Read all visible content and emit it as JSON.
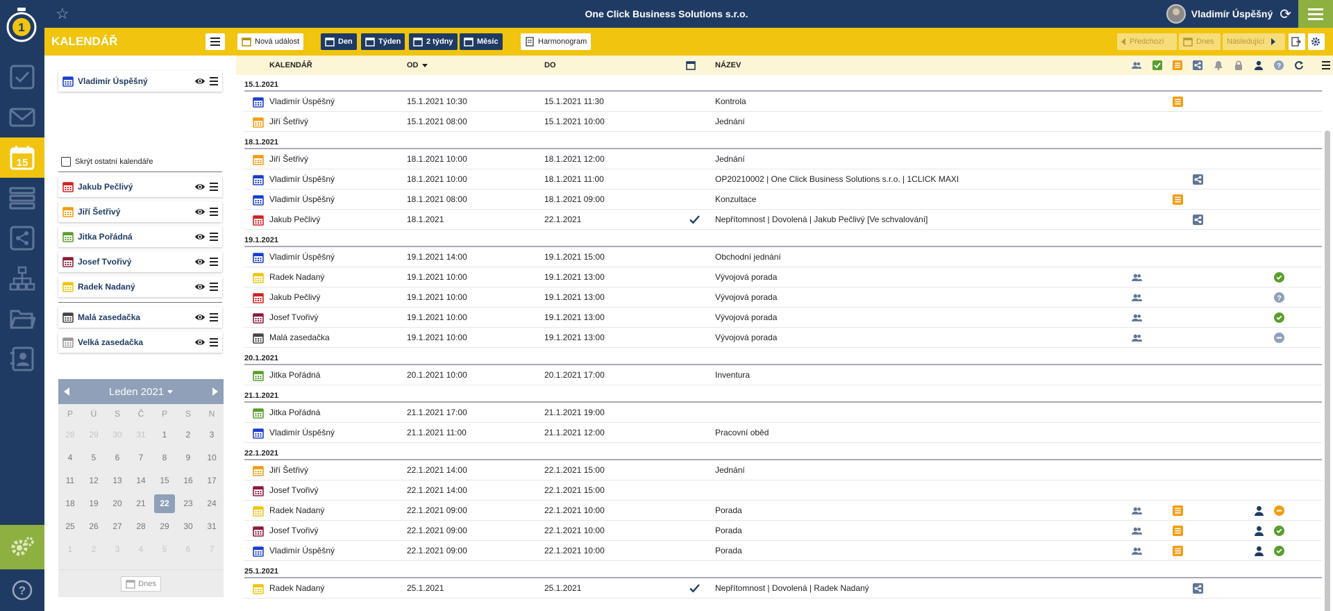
{
  "app": {
    "company": "One Click Business Solutions s.r.o.",
    "user_name": "Vladimír Úspěšný",
    "section_title": "KALENDÁŘ"
  },
  "toolbar": {
    "new_event": "Nová událost",
    "day": "Den",
    "week": "Týden",
    "two_weeks": "2 týdny",
    "month": "Měsíc",
    "schedule": "Harmonogram",
    "prev": "Předchozí",
    "today": "Dnes",
    "next": "Následující"
  },
  "calendars": {
    "own": {
      "name": "Vladimír Úspěšný",
      "color": "#1a3fcf"
    },
    "hide_others_label": "Skrýt ostatní kalendáře",
    "others": [
      {
        "name": "Jakub Pečlivý",
        "color": "#d32121"
      },
      {
        "name": "Jiří Šetřivý",
        "color": "#f39c12"
      },
      {
        "name": "Jitka Pořádná",
        "color": "#5a9e2f"
      },
      {
        "name": "Josef Tvořivý",
        "color": "#8b1a3a"
      },
      {
        "name": "Radek Nadaný",
        "color": "#f1c40f"
      }
    ],
    "rooms": [
      {
        "name": "Malá zasedačka",
        "color": "#444444"
      },
      {
        "name": "Velká zasedačka",
        "color": "#999999"
      }
    ]
  },
  "mini_calendar": {
    "month_label": "Leden 2021",
    "weekdays": [
      "P",
      "Ú",
      "S",
      "Č",
      "P",
      "S",
      "N"
    ],
    "days": [
      "28",
      "29",
      "30",
      "31",
      "1",
      "2",
      "3",
      "4",
      "5",
      "6",
      "7",
      "8",
      "9",
      "10",
      "11",
      "12",
      "13",
      "14",
      "15",
      "16",
      "17",
      "18",
      "19",
      "20",
      "21",
      "22",
      "23",
      "24",
      "25",
      "26",
      "27",
      "28",
      "29",
      "30",
      "31",
      "1",
      "2",
      "3",
      "4",
      "5",
      "6",
      "7"
    ],
    "today_label": "Dnes"
  },
  "table": {
    "headers": {
      "calendar": "KALENDÁŘ",
      "from": "OD",
      "to": "DO",
      "title": "NÁZEV"
    },
    "groups": [
      {
        "date": "15.1.2021",
        "rows": [
          {
            "cal": "Vladimír Úspěšný",
            "color": "#1a3fcf",
            "from": "15.1.2021 10:30",
            "to": "15.1.2021 11:30",
            "title": "Kontrola",
            "icons": [
              "project"
            ]
          },
          {
            "cal": "Jiří Šetřivý",
            "color": "#f39c12",
            "from": "15.1.2021 08:00",
            "to": "15.1.2021 10:00",
            "title": "Jednání",
            "icons": []
          }
        ]
      },
      {
        "date": "18.1.2021",
        "rows": [
          {
            "cal": "Jiří Šetřivý",
            "color": "#f39c12",
            "from": "18.1.2021 10:00",
            "to": "18.1.2021 12:00",
            "title": "Jednání",
            "icons": []
          },
          {
            "cal": "Vladimír Úspěšný",
            "color": "#1a3fcf",
            "from": "18.1.2021 10:00",
            "to": "18.1.2021 11:00",
            "title": "OP20210002 | One Click Business Solutions s.r.o. | 1CLICK MAXI",
            "icons": [
              "process"
            ]
          },
          {
            "cal": "Vladimír Úspěšný",
            "color": "#1a3fcf",
            "from": "18.1.2021 08:00",
            "to": "18.1.2021 09:00",
            "title": "Konzultace",
            "icons": [
              "project"
            ]
          },
          {
            "cal": "Jakub Pečlivý",
            "color": "#d32121",
            "from": "18.1.2021",
            "to": "22.1.2021",
            "title": "Nepřítomnost | Dovolená | Jakub Pečlivý [Ve schvalování]",
            "allday": true,
            "icons": [
              "process"
            ]
          }
        ]
      },
      {
        "date": "19.1.2021",
        "rows": [
          {
            "cal": "Vladimír Úspěšný",
            "color": "#1a3fcf",
            "from": "19.1.2021 14:00",
            "to": "19.1.2021 15:00",
            "title": "Obchodní jednání",
            "icons": []
          },
          {
            "cal": "Radek Nadaný",
            "color": "#f1c40f",
            "from": "19.1.2021 10:00",
            "to": "19.1.2021 13:00",
            "title": "Vývojová porada",
            "icons": [
              "attendees",
              "status-ok"
            ]
          },
          {
            "cal": "Jakub Pečlivý",
            "color": "#d32121",
            "from": "19.1.2021 10:00",
            "to": "19.1.2021 13:00",
            "title": "Vývojová porada",
            "icons": [
              "attendees",
              "status-unknown"
            ]
          },
          {
            "cal": "Josef Tvořivý",
            "color": "#8b1a3a",
            "from": "19.1.2021 10:00",
            "to": "19.1.2021 13:00",
            "title": "Vývojová porada",
            "icons": [
              "attendees",
              "status-ok"
            ]
          },
          {
            "cal": "Malá zasedačka",
            "color": "#444444",
            "from": "19.1.2021 10:00",
            "to": "19.1.2021 13:00",
            "title": "Vývojová porada",
            "icons": [
              "attendees",
              "status-none"
            ]
          }
        ]
      },
      {
        "date": "20.1.2021",
        "rows": [
          {
            "cal": "Jitka Pořádná",
            "color": "#5a9e2f",
            "from": "20.1.2021 10:00",
            "to": "20.1.2021 17:00",
            "title": "Inventura",
            "icons": []
          }
        ]
      },
      {
        "date": "21.1.2021",
        "rows": [
          {
            "cal": "Jitka Pořádná",
            "color": "#5a9e2f",
            "from": "21.1.2021 17:00",
            "to": "21.1.2021 19:00",
            "title": "",
            "icons": []
          },
          {
            "cal": "Vladimír Úspěšný",
            "color": "#1a3fcf",
            "from": "21.1.2021 11:00",
            "to": "21.1.2021 12:00",
            "title": "Pracovní oběd",
            "icons": []
          }
        ]
      },
      {
        "date": "22.1.2021",
        "rows": [
          {
            "cal": "Jiří Šetřivý",
            "color": "#f39c12",
            "from": "22.1.2021 14:00",
            "to": "22.1.2021 15:00",
            "title": "Jednání",
            "icons": []
          },
          {
            "cal": "Josef Tvořivý",
            "color": "#8b1a3a",
            "from": "22.1.2021 14:00",
            "to": "22.1.2021 15:00",
            "title": "",
            "icons": []
          },
          {
            "cal": "Radek Nadaný",
            "color": "#f1c40f",
            "from": "22.1.2021 09:00",
            "to": "22.1.2021 10:00",
            "title": "Porada",
            "icons": [
              "attendees",
              "project",
              "owner",
              "status-tentative"
            ]
          },
          {
            "cal": "Josef Tvořivý",
            "color": "#8b1a3a",
            "from": "22.1.2021 09:00",
            "to": "22.1.2021 10:00",
            "title": "Porada",
            "icons": [
              "attendees",
              "project",
              "owner",
              "status-ok"
            ]
          },
          {
            "cal": "Vladimír Úspěšný",
            "color": "#1a3fcf",
            "from": "22.1.2021 09:00",
            "to": "22.1.2021 10:00",
            "title": "Porada",
            "icons": [
              "attendees",
              "project",
              "owner",
              "status-ok"
            ]
          }
        ]
      },
      {
        "date": "25.1.2021",
        "rows": [
          {
            "cal": "Radek Nadaný",
            "color": "#f1c40f",
            "from": "25.1.2021",
            "to": "25.1.2021",
            "title": "Nepřítomnost | Dovolená | Radek Nadaný",
            "allday": true,
            "icons": [
              "process"
            ]
          }
        ]
      }
    ]
  }
}
